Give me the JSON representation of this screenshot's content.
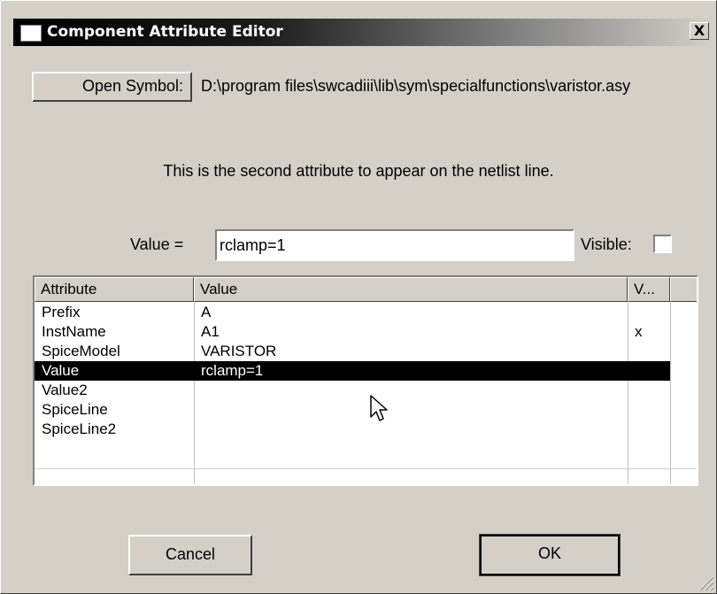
{
  "window": {
    "title": "Component Attribute Editor",
    "close_label": "X"
  },
  "symbol": {
    "button_label": "Open Symbol:",
    "path": "D:\\program files\\swcadiii\\lib\\sym\\specialfunctions\\varistor.asy"
  },
  "description": "This is the second attribute to appear on the netlist line.",
  "value_field": {
    "label": "Value  =",
    "value": "rclamp=1",
    "visible_label": "Visible:",
    "visible_checked": false
  },
  "table": {
    "headers": [
      "Attribute",
      "Value",
      "V..."
    ],
    "rows": [
      {
        "attribute": "Prefix",
        "value": "A",
        "visible": ""
      },
      {
        "attribute": "InstName",
        "value": "A1",
        "visible": "x"
      },
      {
        "attribute": "SpiceModel",
        "value": "VARISTOR",
        "visible": ""
      },
      {
        "attribute": "Value",
        "value": "rclamp=1",
        "visible": "",
        "selected": true
      },
      {
        "attribute": "Value2",
        "value": "",
        "visible": ""
      },
      {
        "attribute": "SpiceLine",
        "value": "",
        "visible": ""
      },
      {
        "attribute": "SpiceLine2",
        "value": "",
        "visible": ""
      }
    ]
  },
  "buttons": {
    "cancel": "Cancel",
    "ok": "OK"
  },
  "colors": {
    "dialog_bg": "#d4d0c8",
    "selection": "#000000",
    "title_start": "#000000"
  }
}
